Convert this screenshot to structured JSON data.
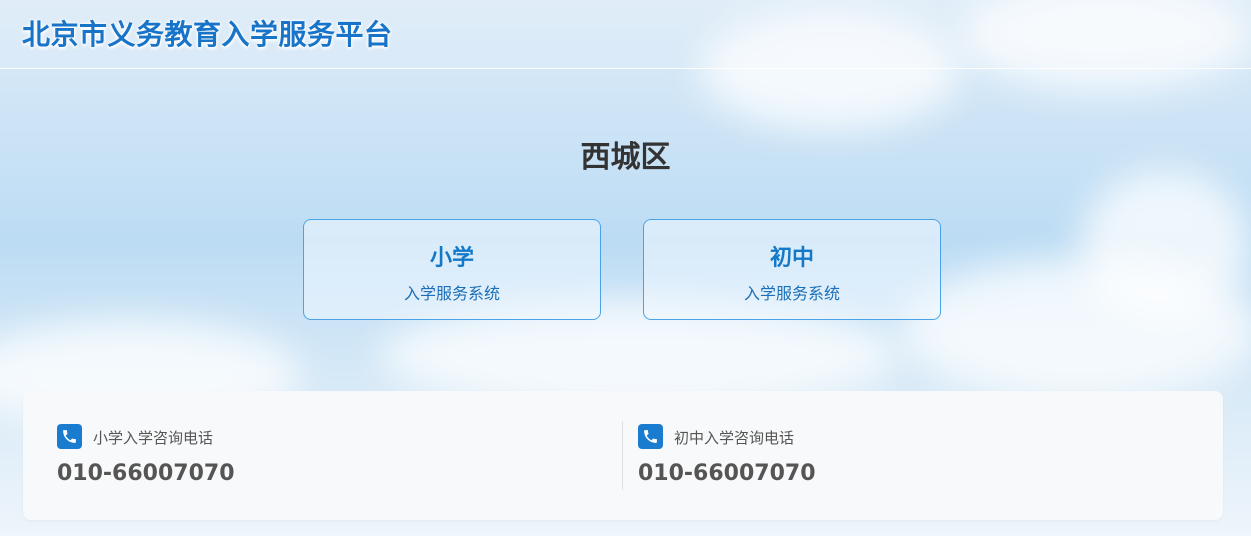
{
  "header": {
    "site_title": "北京市义务教育入学服务平台"
  },
  "main": {
    "district": "西城区",
    "systems": [
      {
        "title": "小学",
        "subtitle": "入学服务系统"
      },
      {
        "title": "初中",
        "subtitle": "入学服务系统"
      }
    ]
  },
  "contacts": [
    {
      "icon": "phone-icon",
      "label": "小学入学咨询电话",
      "number": "010-66007070"
    },
    {
      "icon": "phone-icon",
      "label": "初中入学咨询电话",
      "number": "010-66007070"
    }
  ],
  "colors": {
    "brand_blue": "#1874c8",
    "card_border": "#4aa3e8",
    "icon_bg": "#1a7ccf"
  }
}
